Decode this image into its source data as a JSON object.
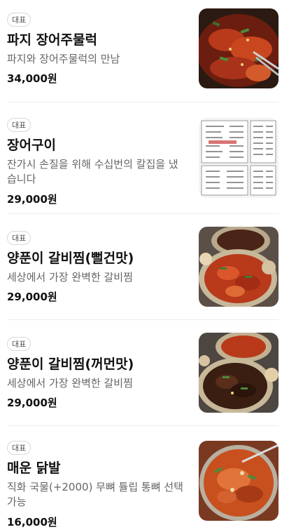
{
  "menu": {
    "items": [
      {
        "badge": "대표",
        "name": "파지 장어주물럭",
        "description": "파지와 장어주물럭의 만남",
        "price": "34,000원",
        "photo_icon": "stir-fried-eel-photo"
      },
      {
        "badge": "대표",
        "name": "장어구이",
        "description": "잔가시 손질을 위해 수십번의 칼집을 냈습니다",
        "price": "29,000원",
        "photo_icon": "menu-board-photo"
      },
      {
        "badge": "대표",
        "name": "양푼이 갈비찜(뻘건맛)",
        "description": "세상에서 가장 완벽한 갈비찜",
        "price": "29,000원",
        "photo_icon": "spicy-galbi-jjim-photo"
      },
      {
        "badge": "대표",
        "name": "양푼이 갈비찜(꺼먼맛)",
        "description": "세상에서 가장 완벽한 갈비찜",
        "price": "29,000원",
        "photo_icon": "soy-galbi-jjim-photo"
      },
      {
        "badge": "대표",
        "name": "매운 닭발",
        "description": "직화 국물(+2000) 무뼈 튤립 통뼈 선택 가능",
        "price": "16,000원",
        "photo_icon": "spicy-chicken-feet-photo"
      }
    ]
  },
  "colors": {
    "badge_border": "#d8d8d8",
    "text_primary": "#111111",
    "text_secondary": "#666666",
    "divider": "#ededed"
  }
}
